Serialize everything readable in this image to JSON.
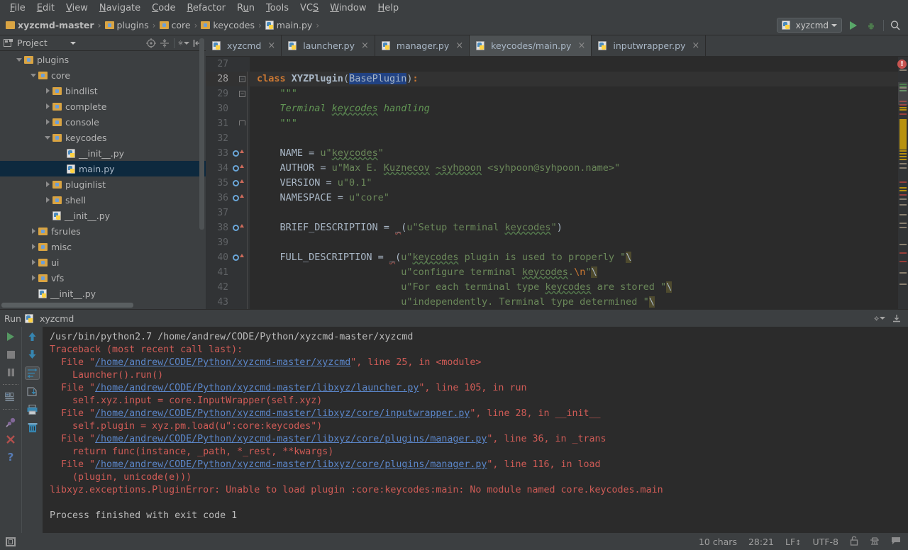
{
  "menubar": {
    "items": [
      {
        "label": "File",
        "mnemonic": "F"
      },
      {
        "label": "Edit",
        "mnemonic": "E"
      },
      {
        "label": "View",
        "mnemonic": "V"
      },
      {
        "label": "Navigate",
        "mnemonic": "N"
      },
      {
        "label": "Code",
        "mnemonic": "C"
      },
      {
        "label": "Refactor",
        "mnemonic": "R"
      },
      {
        "label": "Run",
        "mnemonic": "u"
      },
      {
        "label": "Tools",
        "mnemonic": "T"
      },
      {
        "label": "VCS",
        "mnemonic": "S"
      },
      {
        "label": "Window",
        "mnemonic": "W"
      },
      {
        "label": "Help",
        "mnemonic": "H"
      }
    ]
  },
  "breadcrumb": {
    "items": [
      {
        "label": "xyzcmd-master",
        "type": "folder-root"
      },
      {
        "label": "plugins",
        "type": "folder"
      },
      {
        "label": "core",
        "type": "folder"
      },
      {
        "label": "keycodes",
        "type": "folder"
      },
      {
        "label": "main.py",
        "type": "python-file"
      }
    ]
  },
  "toolbar": {
    "run_configuration": "xyzcmd",
    "run_button": "run-button",
    "debug_button": "debug-button",
    "search_button": "search-everywhere-button"
  },
  "project_panel": {
    "title": "Project",
    "tree": [
      {
        "label": "plugins",
        "depth": 1,
        "state": "expanded",
        "type": "folder"
      },
      {
        "label": "core",
        "depth": 2,
        "state": "expanded",
        "type": "folder"
      },
      {
        "label": "bindlist",
        "depth": 3,
        "state": "collapsed",
        "type": "folder"
      },
      {
        "label": "complete",
        "depth": 3,
        "state": "collapsed",
        "type": "folder"
      },
      {
        "label": "console",
        "depth": 3,
        "state": "collapsed",
        "type": "folder"
      },
      {
        "label": "keycodes",
        "depth": 3,
        "state": "expanded",
        "type": "folder"
      },
      {
        "label": "__init__.py",
        "depth": 4,
        "state": "leaf",
        "type": "python-file"
      },
      {
        "label": "main.py",
        "depth": 4,
        "state": "leaf",
        "type": "python-file",
        "selected": true
      },
      {
        "label": "pluginlist",
        "depth": 3,
        "state": "collapsed",
        "type": "folder"
      },
      {
        "label": "shell",
        "depth": 3,
        "state": "collapsed",
        "type": "folder"
      },
      {
        "label": "__init__.py",
        "depth": 3,
        "state": "leaf",
        "type": "python-file"
      },
      {
        "label": "fsrules",
        "depth": 2,
        "state": "collapsed",
        "type": "folder"
      },
      {
        "label": "misc",
        "depth": 2,
        "state": "collapsed",
        "type": "folder"
      },
      {
        "label": "ui",
        "depth": 2,
        "state": "collapsed",
        "type": "folder"
      },
      {
        "label": "vfs",
        "depth": 2,
        "state": "collapsed",
        "type": "folder"
      },
      {
        "label": "__init__.py",
        "depth": 2,
        "state": "leaf",
        "type": "python-file"
      }
    ]
  },
  "editor": {
    "tabs": [
      {
        "label": "xyzcmd",
        "active": false
      },
      {
        "label": "launcher.py",
        "active": false
      },
      {
        "label": "manager.py",
        "active": false
      },
      {
        "label": "keycodes/main.py",
        "active": true
      },
      {
        "label": "inputwrapper.py",
        "active": false
      }
    ],
    "lines": [
      {
        "num": "27",
        "marker": "",
        "fold": "",
        "text": ""
      },
      {
        "num": "28",
        "marker": "",
        "fold": "minus",
        "text": "class XYZPlugin(BasePlugin):",
        "current": true
      },
      {
        "num": "29",
        "marker": "",
        "fold": "minus",
        "text": "    \"\"\""
      },
      {
        "num": "30",
        "marker": "",
        "fold": "",
        "text": "    Terminal keycodes handling"
      },
      {
        "num": "31",
        "marker": "",
        "fold": "end",
        "text": "    \"\"\""
      },
      {
        "num": "32",
        "marker": "",
        "fold": "",
        "text": ""
      },
      {
        "num": "33",
        "marker": "override",
        "fold": "",
        "text": "    NAME = u\"keycodes\""
      },
      {
        "num": "34",
        "marker": "override",
        "fold": "",
        "text": "    AUTHOR = u\"Max E. Kuznecov ~syhpoon <syhpoon@syhpoon.name>\""
      },
      {
        "num": "35",
        "marker": "override",
        "fold": "",
        "text": "    VERSION = u\"0.1\""
      },
      {
        "num": "36",
        "marker": "override",
        "fold": "",
        "text": "    NAMESPACE = u\"core\""
      },
      {
        "num": "37",
        "marker": "",
        "fold": "",
        "text": ""
      },
      {
        "num": "38",
        "marker": "override",
        "fold": "",
        "text": "    BRIEF_DESCRIPTION = _(u\"Setup terminal keycodes\")"
      },
      {
        "num": "39",
        "marker": "",
        "fold": "",
        "text": ""
      },
      {
        "num": "40",
        "marker": "override",
        "fold": "",
        "text": "    FULL_DESCRIPTION = _(u\"keycodes plugin is used to properly \"\\"
      },
      {
        "num": "41",
        "marker": "",
        "fold": "",
        "text": "                         u\"configure terminal keycodes.\\n\"\\"
      },
      {
        "num": "42",
        "marker": "",
        "fold": "",
        "text": "                         u\"For each terminal type keycodes are stored \"\\"
      },
      {
        "num": "43",
        "marker": "",
        "fold": "",
        "text": "                         u\"independently. Terminal type determined \"\\"
      }
    ],
    "error_badge": "!"
  },
  "run_panel": {
    "title": "Run",
    "config_name": "xyzcmd",
    "console_lines": [
      {
        "kind": "plain",
        "text": "/usr/bin/python2.7 /home/andrew/CODE/Python/xyzcmd-master/xyzcmd"
      },
      {
        "kind": "err",
        "text": "Traceback (most recent call last):"
      },
      {
        "kind": "file",
        "prefix": "  File \"",
        "link": "/home/andrew/CODE/Python/xyzcmd-master/xyzcmd",
        "suffix": "\", line 25, in <module>"
      },
      {
        "kind": "err",
        "text": "    Launcher().run()"
      },
      {
        "kind": "file",
        "prefix": "  File \"",
        "link": "/home/andrew/CODE/Python/xyzcmd-master/libxyz/launcher.py",
        "suffix": "\", line 105, in run"
      },
      {
        "kind": "err",
        "text": "    self.xyz.input = core.InputWrapper(self.xyz)"
      },
      {
        "kind": "file",
        "prefix": "  File \"",
        "link": "/home/andrew/CODE/Python/xyzcmd-master/libxyz/core/inputwrapper.py",
        "suffix": "\", line 28, in __init__"
      },
      {
        "kind": "err",
        "text": "    self.plugin = xyz.pm.load(u\":core:keycodes\")"
      },
      {
        "kind": "file",
        "prefix": "  File \"",
        "link": "/home/andrew/CODE/Python/xyzcmd-master/libxyz/core/plugins/manager.py",
        "suffix": "\", line 36, in _trans"
      },
      {
        "kind": "err",
        "text": "    return func(instance, _path, *_rest, **kwargs)"
      },
      {
        "kind": "file",
        "prefix": "  File \"",
        "link": "/home/andrew/CODE/Python/xyzcmd-master/libxyz/core/plugins/manager.py",
        "suffix": "\", line 116, in load"
      },
      {
        "kind": "err",
        "text": "    (plugin, unicode(e)))"
      },
      {
        "kind": "err",
        "text": "libxyz.exceptions.PluginError: Unable to load plugin :core:keycodes:main: No module named core.keycodes.main"
      },
      {
        "kind": "plain",
        "text": ""
      },
      {
        "kind": "plain",
        "text": "Process finished with exit code 1"
      }
    ],
    "tools_left": [
      "rerun-button",
      "stop-button",
      "pause-button",
      "layout-button",
      "pin-button",
      "close-button",
      "help-button"
    ],
    "tools_right": [
      "scroll-up-button",
      "scroll-down-button",
      "soft-wrap-button",
      "export-button",
      "print-button",
      "clear-all-button"
    ]
  },
  "status_bar": {
    "selection": "10 chars",
    "caret": "28:21",
    "line_separator": "LF",
    "encoding": "UTF-8",
    "icons": [
      "lock-icon",
      "hat-icon",
      "bubble-icon"
    ],
    "left_icon": "project-toggle-icon"
  },
  "colors": {
    "chrome": "#3c3f41",
    "editor_bg": "#2b2b2b",
    "gutter_bg": "#313335",
    "selection_blue": "#214283",
    "tree_selection": "#0d293e",
    "keyword_orange": "#cc7832",
    "string_green": "#6a8759",
    "docstring_green": "#629755",
    "number_blue": "#6897bb",
    "error_red": "#cf5b56",
    "link_blue": "#5b86c9",
    "accent_green": "#59a869",
    "folder_yellow": "#d9a443"
  }
}
